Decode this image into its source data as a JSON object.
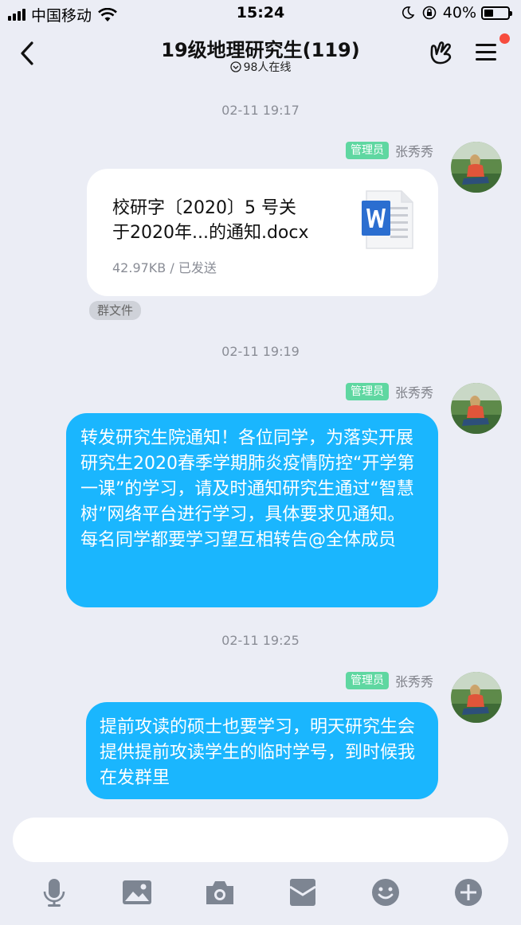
{
  "status_bar": {
    "carrier": "中国移动",
    "time": "15:24",
    "battery": "40%",
    "battery_level": 0.4
  },
  "header": {
    "title": "19级地理研究生(119)",
    "online": "98人在线"
  },
  "messages": [
    {
      "timestamp": "02-11 19:17",
      "role": "管理员",
      "sender": "张秀秀",
      "type": "file",
      "file_name": "校研字〔2020〕5 号关于2020年...的通知.docx",
      "file_name_line1": "校研字〔2020〕5 号关",
      "file_name_line2": "于2020年...的通知.docx",
      "file_meta": "42.97KB / 已发送",
      "tag": "群文件"
    },
    {
      "timestamp": "02-11 19:19",
      "role": "管理员",
      "sender": "张秀秀",
      "type": "text",
      "text": "转发研究生院通知！各位同学，为落实开展研究生2020春季学期肺炎疫情防控“开学第一课”的学习，请及时通知研究生通过“智慧树”网络平台进行学习，具体要求见通知。每名同学都要学习望互相转告@全体成员"
    },
    {
      "timestamp": "02-11 19:25",
      "role": "管理员",
      "sender": "张秀秀",
      "type": "text",
      "text": "提前攻读的硕士也要学习，明天研究生会提供提前攻读学生的临时学号，到时候我在发群里"
    }
  ],
  "input": {
    "placeholder": ""
  },
  "toolbar": [
    "microphone-icon",
    "image-icon",
    "camera-icon",
    "red-packet-icon",
    "emoji-icon",
    "plus-icon"
  ],
  "colors": {
    "background": "#ebedf5",
    "bubble": "#1ab6fe",
    "admin_badge": "#5fd7a1",
    "notification_dot": "#f74c3e"
  }
}
